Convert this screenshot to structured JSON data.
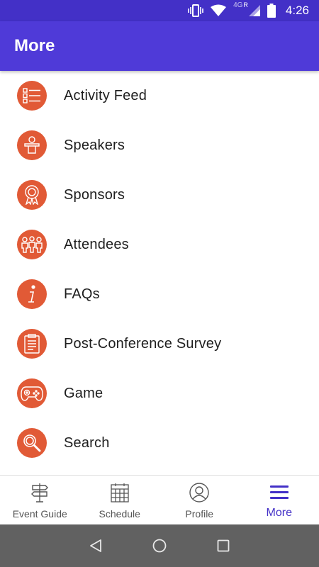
{
  "status_bar": {
    "time": "4:26",
    "network": "4G",
    "roaming": "R"
  },
  "app_bar": {
    "title": "More"
  },
  "menu": {
    "items": [
      {
        "label": "Activity Feed",
        "icon": "list-icon"
      },
      {
        "label": "Speakers",
        "icon": "speaker-podium-icon"
      },
      {
        "label": "Sponsors",
        "icon": "award-ribbon-icon"
      },
      {
        "label": "Attendees",
        "icon": "group-people-icon"
      },
      {
        "label": "FAQs",
        "icon": "info-icon"
      },
      {
        "label": "Post-Conference Survey",
        "icon": "clipboard-icon"
      },
      {
        "label": "Game",
        "icon": "gamepad-icon"
      },
      {
        "label": "Search",
        "icon": "search-icon"
      }
    ]
  },
  "bottom_nav": {
    "tabs": [
      {
        "label": "Event Guide",
        "icon": "signpost-icon",
        "active": false
      },
      {
        "label": "Schedule",
        "icon": "calendar-icon",
        "active": false
      },
      {
        "label": "Profile",
        "icon": "profile-icon",
        "active": false
      },
      {
        "label": "More",
        "icon": "hamburger-menu-icon",
        "active": true
      }
    ]
  },
  "colors": {
    "status_bar": "#4330c7",
    "app_bar": "#4f3ad8",
    "icon_circle": "#e15a36",
    "active_tab": "#4330c7",
    "system_nav": "#616161"
  }
}
